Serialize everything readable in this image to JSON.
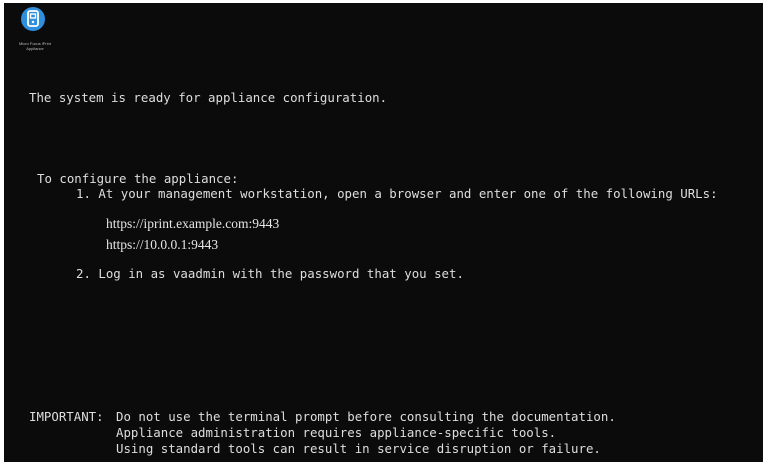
{
  "logo": {
    "icon": "printer-icon",
    "brand_lines": [
      "Micro Focus iPrint",
      "Appliance"
    ],
    "badge_color": "#2f8fdd"
  },
  "console": {
    "background": "#0b0b0b",
    "text_color": "#dedede",
    "ready_message": "The system is ready for appliance configuration.",
    "configure_heading": "To configure the appliance:",
    "step1": "1. At your management workstation, open a browser and enter one of the following URLs:",
    "urls": [
      "https://iprint.example.com:9443",
      "https://10.0.0.1:9443"
    ],
    "step2": "2. Log in as vaadmin with the password that you set.",
    "important_label": "IMPORTANT:",
    "important_lines": [
      "Do not use the terminal prompt before consulting the documentation.",
      "Appliance administration requires appliance-specific tools.",
      "Using standard tools can result in service disruption or failure."
    ]
  }
}
